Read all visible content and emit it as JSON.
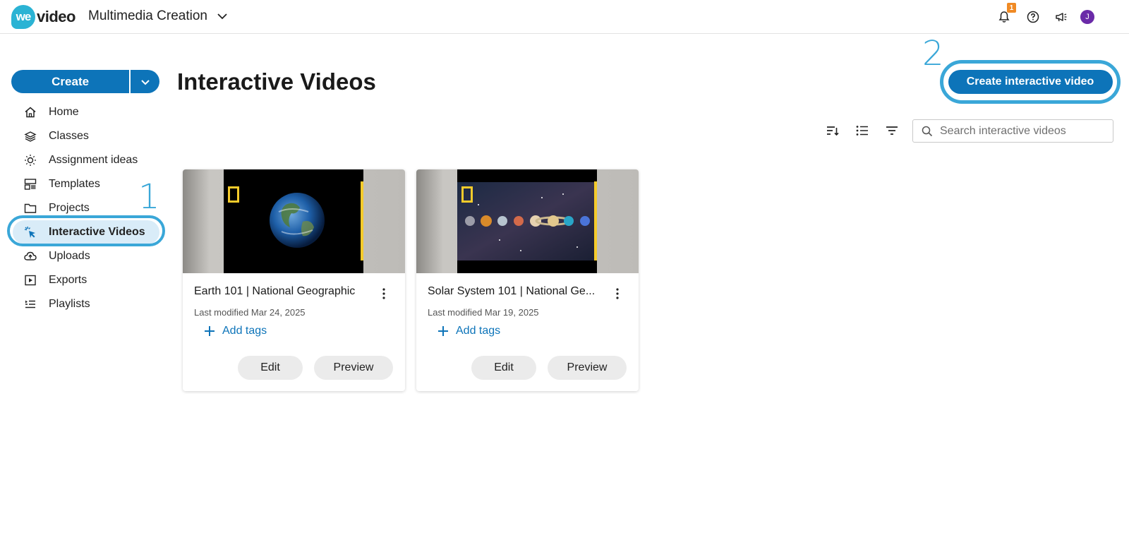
{
  "header": {
    "logo_we": "we",
    "logo_video": "video",
    "workspace_title": "Multimedia Creation",
    "notification_count": "1",
    "avatar_initial": "J"
  },
  "sidebar": {
    "create_label": "Create",
    "items": [
      {
        "label": "Home",
        "icon": "home-icon"
      },
      {
        "label": "Classes",
        "icon": "classes-icon"
      },
      {
        "label": "Assignment ideas",
        "icon": "lightbulb-icon"
      },
      {
        "label": "Templates",
        "icon": "templates-icon"
      },
      {
        "label": "Projects",
        "icon": "folder-icon"
      },
      {
        "label": "Interactive Videos",
        "icon": "cursor-click-icon",
        "active": true
      },
      {
        "label": "Uploads",
        "icon": "cloud-upload-icon"
      },
      {
        "label": "Exports",
        "icon": "export-icon"
      },
      {
        "label": "Playlists",
        "icon": "playlist-icon"
      }
    ]
  },
  "annotations": {
    "step1": "1",
    "step2": "2",
    "color": "#3aa7d8"
  },
  "main": {
    "title": "Interactive Videos",
    "create_button": "Create interactive video",
    "search_placeholder": "Search interactive videos",
    "toolbar": [
      "sort-icon",
      "list-view-icon",
      "filter-icon"
    ]
  },
  "cards": [
    {
      "title": "Earth 101 | National Geographic",
      "modified": "Last modified Mar 24, 2025",
      "add_tags": "Add tags",
      "edit": "Edit",
      "preview": "Preview"
    },
    {
      "title": "Solar System 101 | National Ge...",
      "modified": "Last modified Mar 19, 2025",
      "add_tags": "Add tags",
      "edit": "Edit",
      "preview": "Preview"
    }
  ],
  "colors": {
    "primary": "#0d74b9",
    "active_bg": "#d9ecf8",
    "badge": "#f08a24",
    "avatar": "#6a2aa8",
    "natgeo_yellow": "#f5cb2b"
  }
}
